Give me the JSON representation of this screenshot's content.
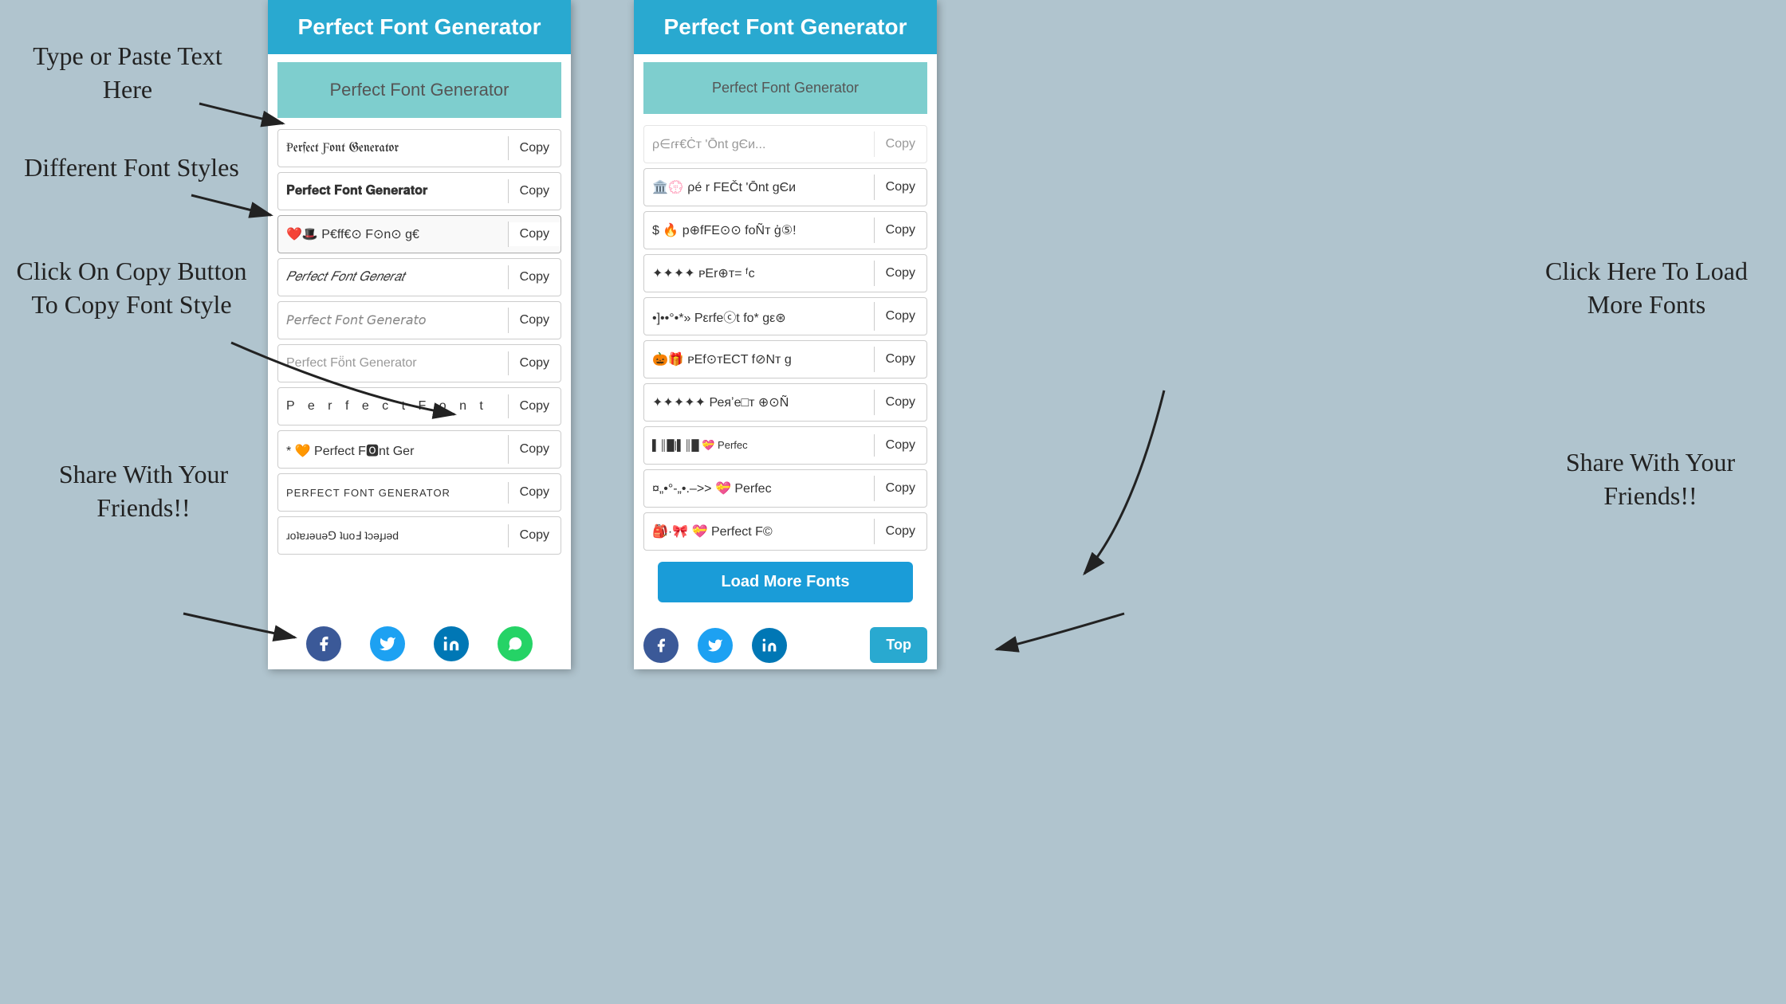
{
  "app": {
    "title": "Perfect Font Generator",
    "background_color": "#b0c4ce"
  },
  "phone1": {
    "header": "Perfect Font Generator",
    "input_placeholder": "Perfect Font Generator",
    "font_rows": [
      {
        "text": "Ᵽerfect Ƒont Generator",
        "copy": "Copy",
        "style": "blackletter"
      },
      {
        "text": "𝐏𝐞𝐫𝐟𝐞𝐜𝐭 𝐅𝐨𝐧𝐭 𝐆𝐞𝐧𝐞𝐫𝐚𝐭𝐨𝐫",
        "copy": "Copy",
        "style": "bold"
      },
      {
        "text": "❤️🎩 P€ff€⊙ F⊙n⊙ g€",
        "copy": "Copy",
        "style": "emoji1"
      },
      {
        "text": "𝑃𝑒𝑟𝑓𝑒𝑐𝑡 𝐹𝑜𝑛𝑡 𝐺𝑒𝑛𝑒𝑟𝑎𝑡",
        "copy": "Copy",
        "style": "italic"
      },
      {
        "text": "𝘗𝘦𝘳𝘧𝘦𝘤𝘵 𝘍𝘰𝘯𝘵 𝘎𝘦𝘯𝘦𝘳𝘢𝘵𝘰",
        "copy": "Copy",
        "style": "italic2"
      },
      {
        "text": "Perfect Fö̈nt Generator",
        "copy": "Copy",
        "style": "light"
      },
      {
        "text": "P e r f e c t  F o n t",
        "copy": "Copy",
        "style": "spaced"
      },
      {
        "text": "* 🧡 Perfect F🅾nt Ger",
        "copy": "Copy",
        "style": "emoji2"
      },
      {
        "text": "PERFECT FONT GENERATOR",
        "copy": "Copy",
        "style": "upper"
      },
      {
        "text": "ɹoʇɐɹǝuǝ⅁ ʇuoℲ ʇɔǝɟɹǝd",
        "copy": "Copy",
        "style": "upsidedown"
      }
    ],
    "share": {
      "facebook": "f",
      "twitter": "t",
      "linkedin": "in",
      "whatsapp": "w"
    }
  },
  "phone2": {
    "header": "Perfect Font Generator",
    "input_placeholder": "Perfect Font Generator",
    "font_rows": [
      {
        "text": "ρ∈ɾғ€Ċт 'Ōnt gЄи",
        "copy": "Copy",
        "style": "sym1"
      },
      {
        "text": "$ 🔥 p⊕fFE⊙⊙ foÑт ģ⑤!",
        "copy": "Copy",
        "style": "sym2"
      },
      {
        "text": "✦✦✦✦ ᴘEr⊕ᴛ= ᶠc",
        "copy": "Copy",
        "style": "sym3"
      },
      {
        "text": "•]••°•*»  Pεrfeⓒt fo* gε⊛",
        "copy": "Copy",
        "style": "sym4"
      },
      {
        "text": "🎃🎁 ᴘEf⊙ᴛECT f⊘Nт g",
        "copy": "Copy",
        "style": "sym5"
      },
      {
        "text": "✦✦✦✦✦ Реяʼе□т ⊕⊙Ñ",
        "copy": "Copy",
        "style": "sym6"
      },
      {
        "text": "▌║█|▌║█ 💝 Perfec",
        "copy": "Copy",
        "style": "barcode"
      },
      {
        "text": "¤„•°-„•.–>> 💝 Perfec",
        "copy": "Copy",
        "style": "sym7"
      },
      {
        "text": "🎒·🎀 💝 Perfect F©",
        "copy": "Copy",
        "style": "sym8"
      }
    ],
    "load_more": "Load More Fonts",
    "top_btn": "Top",
    "share": {
      "facebook": "f",
      "twitter": "t",
      "linkedin": "in"
    }
  },
  "annotations": {
    "type_paste": "Type or Paste Text\nHere",
    "different_fonts": "Different Font\nStyles",
    "click_copy": "Click On Copy\nButton To Copy\nFont Style",
    "share": "Share With\nYour\nFriends!!",
    "click_load": "Click Here To\nLoad More\nFonts",
    "share2": "Share With\nYour\nFriends!!"
  }
}
